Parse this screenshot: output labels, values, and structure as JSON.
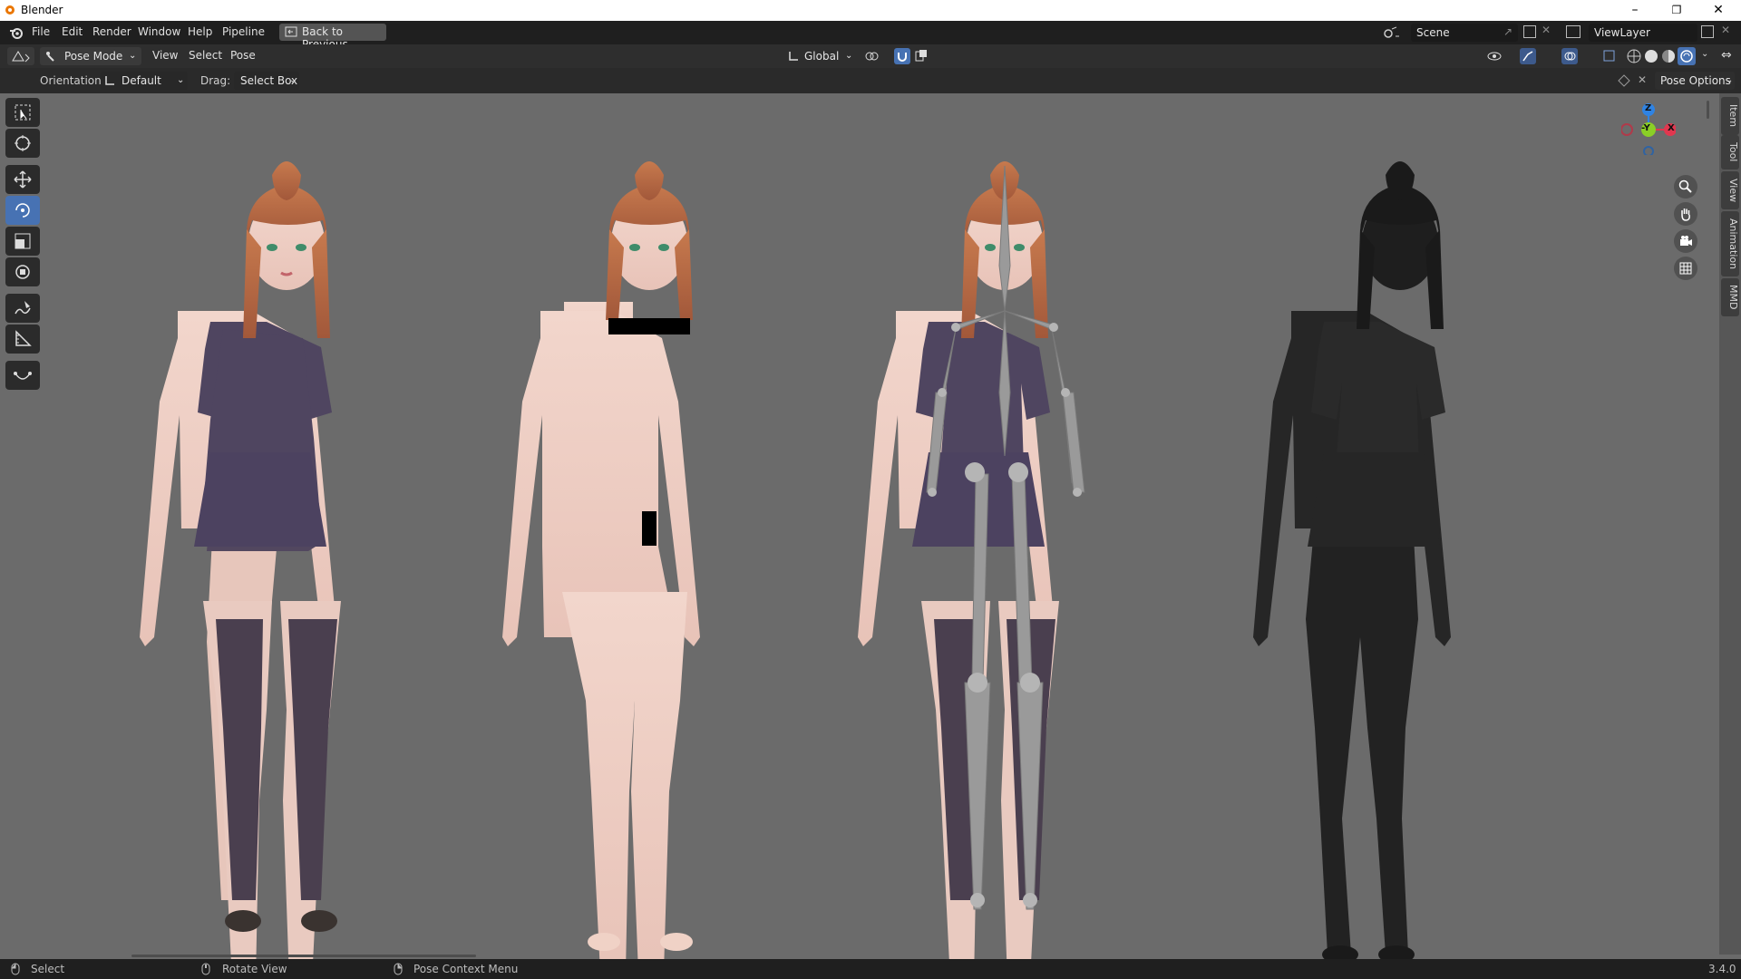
{
  "window": {
    "title": "Blender",
    "minimize": "–",
    "maximize": "❐",
    "close": "✕"
  },
  "topbar": {
    "menus": [
      "File",
      "Edit",
      "Render",
      "Window",
      "Help",
      "Pipeline"
    ],
    "back_button": "Back to Previous",
    "scene": "Scene",
    "view_layer": "ViewLayer"
  },
  "header": {
    "mode": "Pose Mode",
    "menus": [
      "View",
      "Select",
      "Pose"
    ],
    "orientation_global": "Global"
  },
  "tool_settings": {
    "orientation_label": "Orientation:",
    "orientation_value": "Default",
    "drag_label": "Drag:",
    "drag_value": "Select Box",
    "pose_options": "Pose Options"
  },
  "sidebar_tabs": [
    "Item",
    "Tool",
    "View",
    "Animation",
    "MMD"
  ],
  "gizmo": {
    "z": "Z",
    "y": "-Y",
    "x": "X"
  },
  "tools": [
    "select-box-icon",
    "cursor-icon",
    "move-icon",
    "rotate-icon",
    "scale-icon",
    "transform-icon",
    "annotate-icon",
    "measure-icon",
    "pose-curve-icon"
  ],
  "status": {
    "select": "Select",
    "rotate_view": "Rotate View",
    "context_menu": "Pose Context Menu",
    "version": "3.4.0"
  },
  "colors": {
    "accent": "#4772b3",
    "axis_x": "#e0374f",
    "axis_y": "#8bcf26",
    "axis_z": "#2f83e3"
  }
}
